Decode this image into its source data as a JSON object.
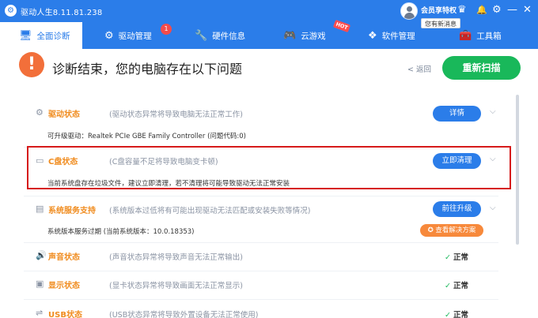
{
  "app": {
    "logo_glyph": "⚙",
    "title": "驱动人生8.11.81.238"
  },
  "titlebar": {
    "member_text": "会员享特权",
    "message_tip": "您有新消息",
    "icons": [
      {
        "name": "crown-icon",
        "glyph": "♛"
      },
      {
        "name": "bell-icon",
        "glyph": "🔔"
      },
      {
        "name": "gear-icon",
        "glyph": "⚙"
      },
      {
        "name": "minimize-icon",
        "glyph": "—"
      },
      {
        "name": "close-icon",
        "glyph": "✕"
      }
    ]
  },
  "nav": {
    "items": [
      {
        "label": "全面诊断",
        "icon": "monitor-icon",
        "glyph": "🖥",
        "active": true
      },
      {
        "label": "驱动管理",
        "icon": "gear-icon",
        "glyph": "⚙",
        "badge": "1"
      },
      {
        "label": "硬件信息",
        "icon": "wrench-icon",
        "glyph": "🔧"
      },
      {
        "label": "云游戏",
        "icon": "gamepad-icon",
        "glyph": "🎮",
        "tag": "HOT"
      },
      {
        "label": "软件管理",
        "icon": "apps-icon",
        "glyph": "❖"
      },
      {
        "label": "工具箱",
        "icon": "toolbox-icon",
        "glyph": "🧰"
      }
    ]
  },
  "header": {
    "warn_glyph": "!",
    "title": "诊断结束，您的电脑存在以下问题",
    "back_label": "< 返回",
    "rescan_label": "重新扫描"
  },
  "rows": [
    {
      "title": "驱动状态",
      "glyph": "⚙",
      "desc": "(驱动状态异常将导致电脑无法正常工作)",
      "sub": "可升级驱动：Realtek PCIe GBE Family Controller (问题代码:0)",
      "action": "详情",
      "chevron": "⌵",
      "color": "#f08c1f"
    },
    {
      "title": "C盘状态",
      "glyph": "▭",
      "desc": "(C盘容量不足将导致电脑变卡顿)",
      "sub": "当前系统盘存在垃圾文件，建议立即清理，若不清理将可能导致驱动无法正常安装",
      "action": "立即清理",
      "chevron": "⌵",
      "color": "#f08c1f"
    },
    {
      "title": "系统服务支持",
      "glyph": "▤",
      "desc": "(系统版本过低将有可能出现驱动无法匹配或安装失败等情况)",
      "sub": "系统版本服务过期 (当前系统版本：10.0.18353)",
      "action": "前往升级",
      "chevron": "⌵",
      "color": "#f08c1f",
      "solution_label": "✪ 查看解决方案"
    },
    {
      "title": "声音状态",
      "glyph": "🔊",
      "desc": "(声音状态异常将导致声音无法正常输出)",
      "status": "正常",
      "color": "#f08c1f"
    },
    {
      "title": "显示状态",
      "glyph": "▣",
      "desc": "(显卡状态异常将导致画面无法正常显示)",
      "status": "正常",
      "color": "#f08c1f"
    },
    {
      "title": "USB状态",
      "glyph": "⇌",
      "desc": "(USB状态异常将导致外置设备无法正常使用)",
      "status": "正常",
      "color": "#f08c1f"
    }
  ],
  "check_glyph": "✓"
}
